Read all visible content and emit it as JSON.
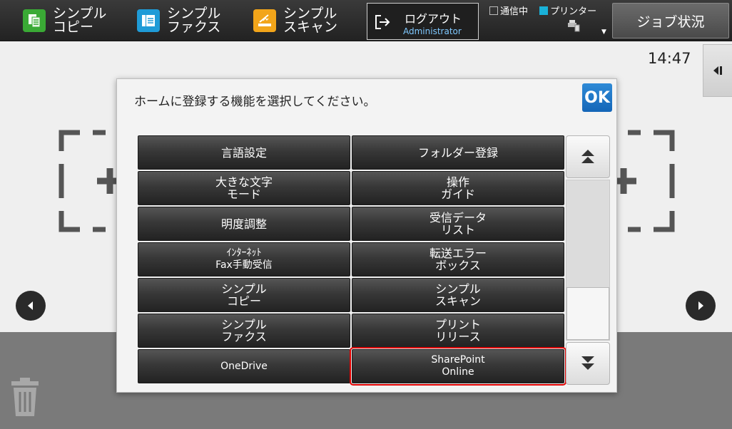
{
  "topbar": {
    "shortcuts": [
      {
        "label": "シンプル\nコピー",
        "icon": "copy-icon",
        "color": "#3aaa35"
      },
      {
        "label": "シンプル\nファクス",
        "icon": "fax-icon",
        "color": "#1f9bd7"
      },
      {
        "label": "シンプル\nスキャン",
        "icon": "scan-icon",
        "color": "#f2a51a"
      }
    ],
    "logout": {
      "label": "ログアウト",
      "user": "Administrator"
    },
    "status": {
      "comm_label": "通信中",
      "printer_label": "プリンター"
    },
    "job_status_label": "ジョブ状況"
  },
  "home": {
    "clock": "14:47"
  },
  "dialog": {
    "title": "ホームに登録する機能を選択してください。",
    "ok_label": "OK",
    "buttons": [
      {
        "label": "言語設定"
      },
      {
        "label": "フォルダー登録"
      },
      {
        "label": "大きな文字\nモード"
      },
      {
        "label": "操作\nガイド"
      },
      {
        "label": "明度調整"
      },
      {
        "label": "受信データ\nリスト"
      },
      {
        "label": "ｲﾝﾀｰﾈｯﾄ\nFax手動受信"
      },
      {
        "label": "転送エラー\nボックス"
      },
      {
        "label": "シンプル\nコピー"
      },
      {
        "label": "シンプル\nスキャン"
      },
      {
        "label": "シンプル\nファクス"
      },
      {
        "label": "プリント\nリリース"
      },
      {
        "label": "OneDrive"
      },
      {
        "label": "SharePoint\nOnline"
      }
    ],
    "selected_index": 13
  },
  "colors": {
    "accent": "#1466b8",
    "selection": "#e00000"
  }
}
